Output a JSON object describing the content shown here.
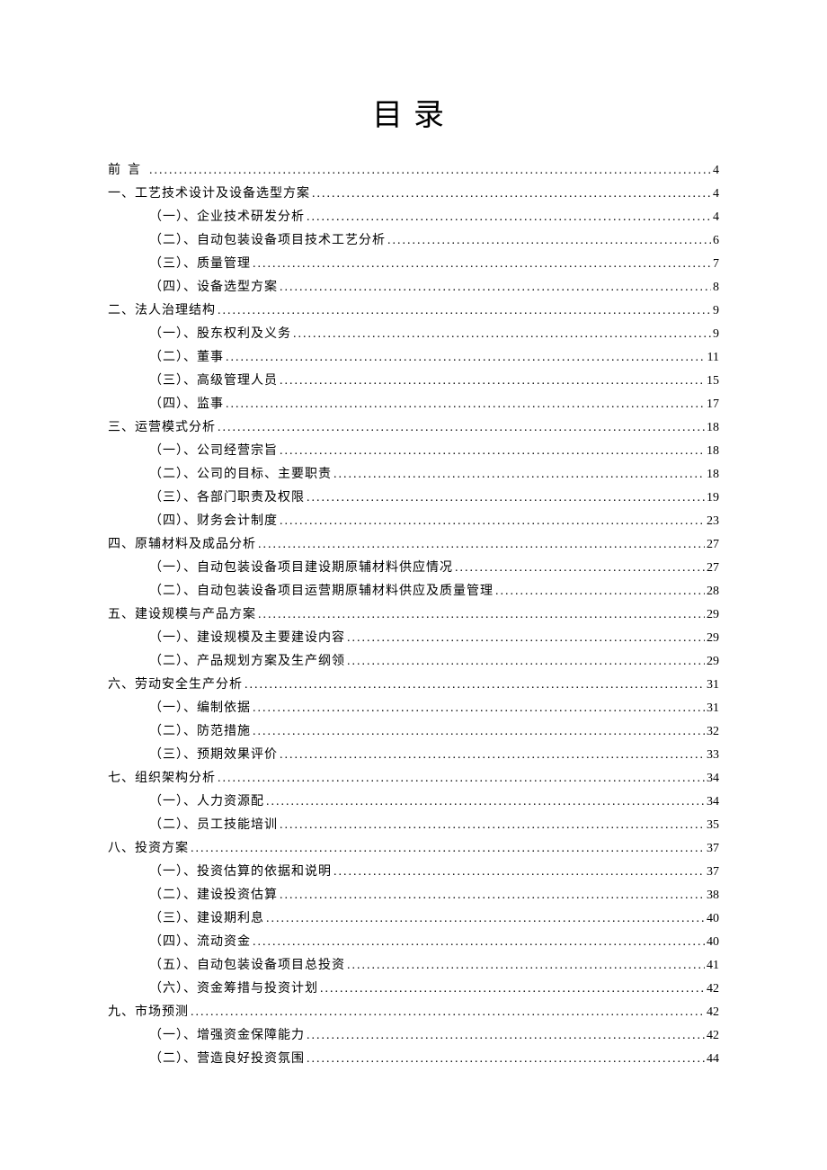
{
  "title": "目录",
  "toc": [
    {
      "level": 0,
      "label": "前言",
      "page": "4",
      "klass": "preface"
    },
    {
      "level": 0,
      "label": "一、工艺技术设计及设备选型方案",
      "page": "4"
    },
    {
      "level": 1,
      "label": "（一）、企业技术研发分析",
      "page": "4"
    },
    {
      "level": 1,
      "label": "（二）、自动包装设备项目技术工艺分析",
      "page": "6"
    },
    {
      "level": 1,
      "label": "（三）、质量管理",
      "page": "7"
    },
    {
      "level": 1,
      "label": "（四）、设备选型方案",
      "page": "8"
    },
    {
      "level": 0,
      "label": "二、法人治理结构",
      "page": "9"
    },
    {
      "level": 1,
      "label": "（一）、股东权利及义务",
      "page": "9"
    },
    {
      "level": 1,
      "label": "（二）、董事",
      "page": "11"
    },
    {
      "level": 1,
      "label": "（三）、高级管理人员",
      "page": "15"
    },
    {
      "level": 1,
      "label": "（四）、监事",
      "page": "17"
    },
    {
      "level": 0,
      "label": "三、运营模式分析",
      "page": "18"
    },
    {
      "level": 1,
      "label": "（一）、公司经营宗旨",
      "page": "18"
    },
    {
      "level": 1,
      "label": "（二）、公司的目标、主要职责",
      "page": "18"
    },
    {
      "level": 1,
      "label": "（三）、各部门职责及权限",
      "page": "19"
    },
    {
      "level": 1,
      "label": "（四）、财务会计制度",
      "page": "23"
    },
    {
      "level": 0,
      "label": "四、原辅材料及成品分析",
      "page": "27"
    },
    {
      "level": 1,
      "label": "（一）、自动包装设备项目建设期原辅材料供应情况",
      "page": "27"
    },
    {
      "level": 1,
      "label": "（二）、自动包装设备项目运营期原辅材料供应及质量管理",
      "page": "28"
    },
    {
      "level": 0,
      "label": "五、建设规模与产品方案",
      "page": "29"
    },
    {
      "level": 1,
      "label": "（一）、建设规模及主要建设内容",
      "page": "29"
    },
    {
      "level": 1,
      "label": "（二）、产品规划方案及生产纲领",
      "page": "29"
    },
    {
      "level": 0,
      "label": "六、劳动安全生产分析",
      "page": "31"
    },
    {
      "level": 1,
      "label": "（一）、编制依据",
      "page": "31"
    },
    {
      "level": 1,
      "label": "（二）、防范措施",
      "page": "32"
    },
    {
      "level": 1,
      "label": "（三）、预期效果评价",
      "page": "33"
    },
    {
      "level": 0,
      "label": "七、组织架构分析",
      "page": "34"
    },
    {
      "level": 1,
      "label": "（一）、人力资源配",
      "page": "34"
    },
    {
      "level": 1,
      "label": "（二）、员工技能培训",
      "page": "35"
    },
    {
      "level": 0,
      "label": "八、投资方案",
      "page": "37"
    },
    {
      "level": 1,
      "label": "（一）、投资估算的依据和说明",
      "page": "37"
    },
    {
      "level": 1,
      "label": "（二）、建设投资估算",
      "page": "38"
    },
    {
      "level": 1,
      "label": "（三）、建设期利息",
      "page": "40"
    },
    {
      "level": 1,
      "label": "（四）、流动资金",
      "page": "40"
    },
    {
      "level": 1,
      "label": "（五）、自动包装设备项目总投资",
      "page": "41"
    },
    {
      "level": 1,
      "label": "（六）、资金筹措与投资计划",
      "page": "42"
    },
    {
      "level": 0,
      "label": "九、市场预测",
      "page": "42"
    },
    {
      "level": 1,
      "label": "（一）、增强资金保障能力",
      "page": "42"
    },
    {
      "level": 1,
      "label": "（二）、营造良好投资氛围",
      "page": "44"
    }
  ]
}
